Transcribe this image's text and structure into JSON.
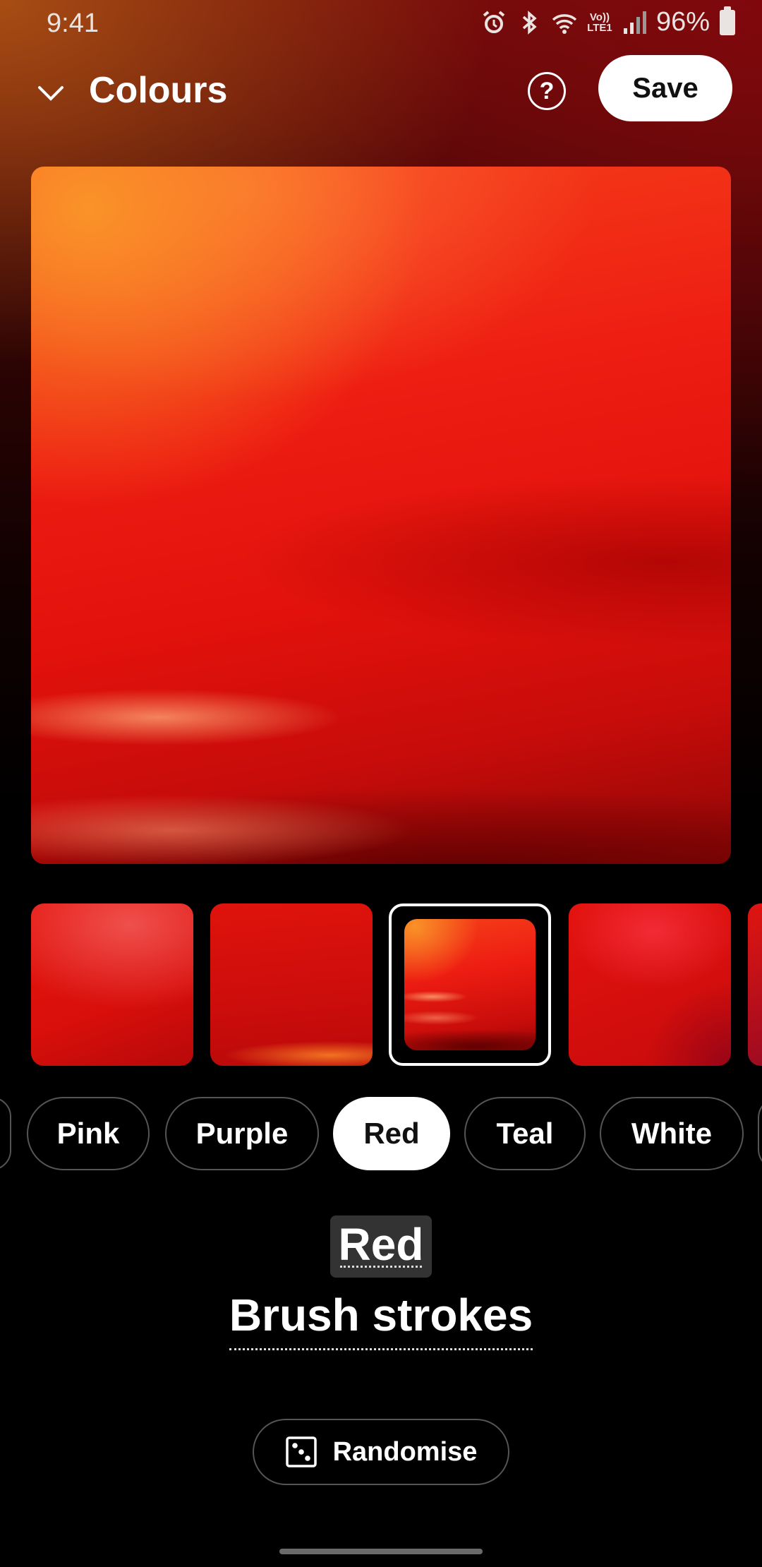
{
  "status_bar": {
    "time": "9:41",
    "lte_label": "Vo)) LTE1",
    "battery": "96%"
  },
  "header": {
    "title": "Colours",
    "help_label": "?",
    "save_label": "Save"
  },
  "chips": {
    "items": [
      "Pink",
      "Purple",
      "Red",
      "Teal",
      "White"
    ],
    "selected": "Red"
  },
  "caption": {
    "style": "Red",
    "pattern": "Brush strokes"
  },
  "randomise_label": "Randomise",
  "colors": {
    "background": "#000000",
    "accent_red": "#e2110c",
    "chip_active_bg": "#ffffff"
  }
}
